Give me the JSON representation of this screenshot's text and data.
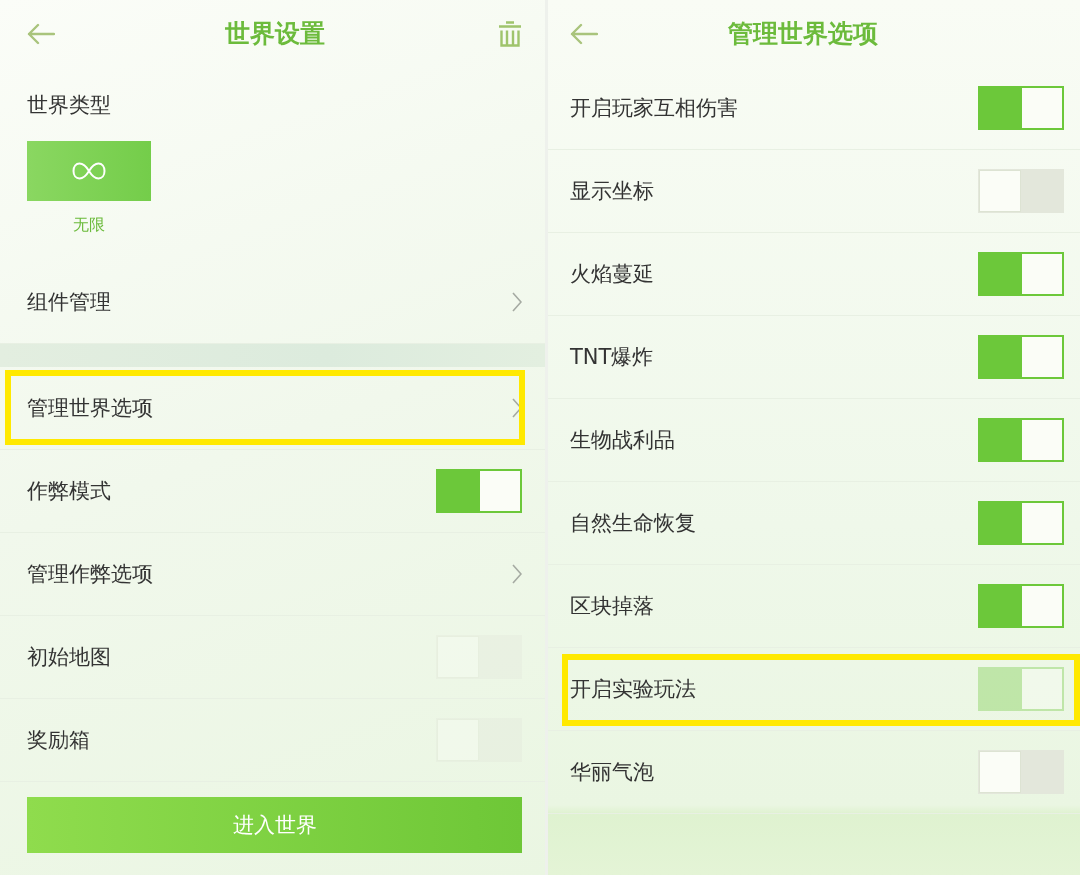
{
  "world_settings": {
    "title": "世界设置",
    "world_type": {
      "label": "世界类型",
      "options": [
        {
          "label": "无限",
          "selected": true
        }
      ]
    },
    "groups": [
      [
        {
          "kind": "link",
          "label": "组件管理",
          "highlighted": false
        }
      ],
      [
        {
          "kind": "link",
          "label": "管理世界选项",
          "highlighted": true
        },
        {
          "kind": "toggle",
          "label": "作弊模式",
          "on": true,
          "disabled": false,
          "highlighted": false
        },
        {
          "kind": "link",
          "label": "管理作弊选项",
          "highlighted": false
        },
        {
          "kind": "toggle",
          "label": "初始地图",
          "on": false,
          "disabled": true,
          "highlighted": false
        },
        {
          "kind": "toggle",
          "label": "奖励箱",
          "on": false,
          "disabled": true,
          "highlighted": false
        }
      ]
    ],
    "enter_button": "进入世界"
  },
  "world_options": {
    "title": "管理世界选项",
    "rows": [
      {
        "kind": "toggle",
        "label": "开启玩家互相伤害",
        "on": true,
        "disabled": false,
        "highlighted": false
      },
      {
        "kind": "toggle",
        "label": "显示坐标",
        "on": false,
        "disabled": false,
        "highlighted": false
      },
      {
        "kind": "toggle",
        "label": "火焰蔓延",
        "on": true,
        "disabled": false,
        "highlighted": false
      },
      {
        "kind": "toggle",
        "label": "TNT爆炸",
        "on": true,
        "disabled": false,
        "highlighted": false
      },
      {
        "kind": "toggle",
        "label": "生物战利品",
        "on": true,
        "disabled": false,
        "highlighted": false
      },
      {
        "kind": "toggle",
        "label": "自然生命恢复",
        "on": true,
        "disabled": false,
        "highlighted": false
      },
      {
        "kind": "toggle",
        "label": "区块掉落",
        "on": true,
        "disabled": false,
        "highlighted": false
      },
      {
        "kind": "toggle",
        "label": "开启实验玩法",
        "on": true,
        "disabled": true,
        "highlighted": true
      },
      {
        "kind": "toggle",
        "label": "华丽气泡",
        "on": false,
        "disabled": false,
        "highlighted": false
      }
    ]
  }
}
